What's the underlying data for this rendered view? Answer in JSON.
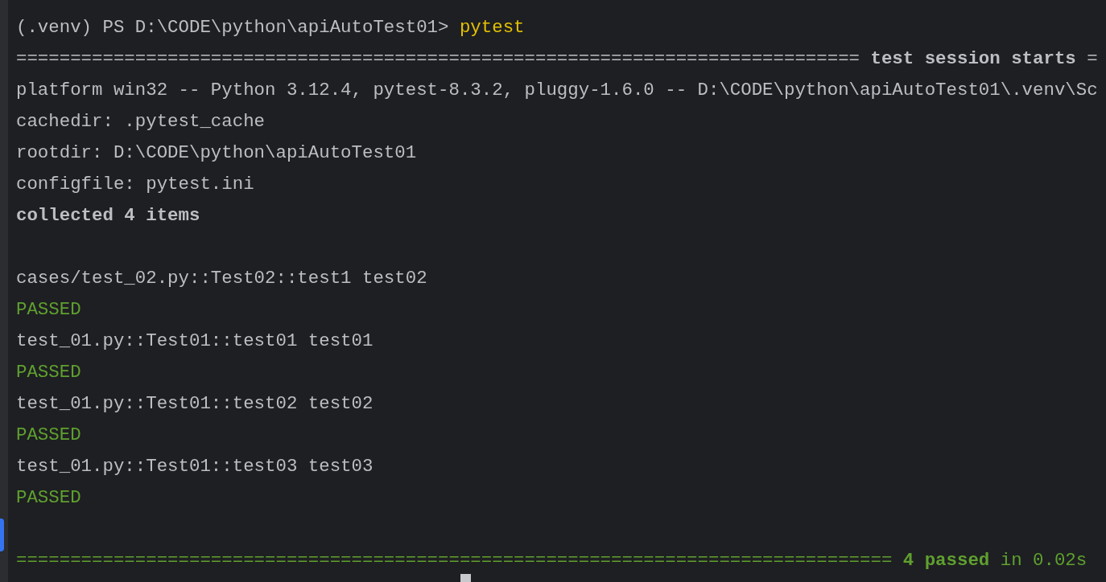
{
  "terminal": {
    "lines": [
      {
        "kind": "prompt",
        "prompt": "(.venv) PS D:\\CODE\\python\\apiAutoTest01> ",
        "command": "pytest"
      },
      {
        "kind": "text",
        "text": "============================================================================== **test session starts** ="
      },
      {
        "kind": "text",
        "text": "platform win32 -- Python 3.12.4, pytest-8.3.2, pluggy-1.6.0 -- D:\\CODE\\python\\apiAutoTest01\\.venv\\Sc"
      },
      {
        "kind": "text",
        "text": "cachedir: .pytest_cache"
      },
      {
        "kind": "text",
        "text": "rootdir: D:\\CODE\\python\\apiAutoTest01"
      },
      {
        "kind": "text",
        "text": "configfile: pytest.ini"
      },
      {
        "kind": "heading",
        "text": "collected 4 items"
      },
      {
        "kind": "blank"
      },
      {
        "kind": "text",
        "text": "cases/test_02.py::Test02::test1 test02"
      },
      {
        "kind": "passed",
        "text": "PASSED"
      },
      {
        "kind": "text",
        "text": "test_01.py::Test01::test01 test01"
      },
      {
        "kind": "passed",
        "text": "PASSED"
      },
      {
        "kind": "text",
        "text": "test_01.py::Test01::test02 test02"
      },
      {
        "kind": "passed",
        "text": "PASSED"
      },
      {
        "kind": "text",
        "text": "test_01.py::Test01::test03 test03"
      },
      {
        "kind": "passed",
        "text": "PASSED"
      },
      {
        "kind": "blank"
      },
      {
        "kind": "passed",
        "text": "================================================================================= **4 passed** in 0.02s"
      }
    ]
  }
}
